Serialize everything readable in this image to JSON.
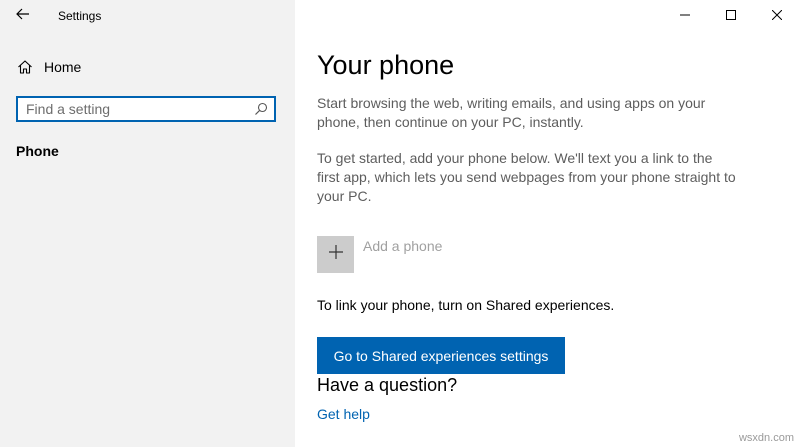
{
  "window": {
    "app_title": "Settings",
    "controls": {
      "minimize_icon": "minimize-icon",
      "maximize_icon": "maximize-icon",
      "close_icon": "close-icon"
    }
  },
  "sidebar": {
    "back_icon": "back-arrow-icon",
    "home": {
      "label": "Home",
      "icon": "home-icon"
    },
    "search": {
      "placeholder": "Find a setting",
      "value": "",
      "icon": "search-icon"
    },
    "items": [
      {
        "label": "Phone",
        "selected": true
      }
    ]
  },
  "main": {
    "title": "Your phone",
    "description1": "Start browsing the web, writing emails, and using apps on your phone, then continue on your PC, instantly.",
    "description2": "To get started, add your phone below. We'll text you a link to the first app, which lets you send webpages from your phone straight to your PC.",
    "add_phone": {
      "label": "Add a phone",
      "icon": "plus-icon"
    },
    "link_text": "To link your phone, turn on Shared experiences.",
    "shared_button": "Go to Shared experiences settings",
    "question_title": "Have a question?",
    "get_help": "Get help"
  },
  "watermark": "wsxdn.com",
  "colors": {
    "accent": "#0063b1",
    "sidebar_bg": "#f2f2f2",
    "add_box_bg": "#cccccc"
  }
}
